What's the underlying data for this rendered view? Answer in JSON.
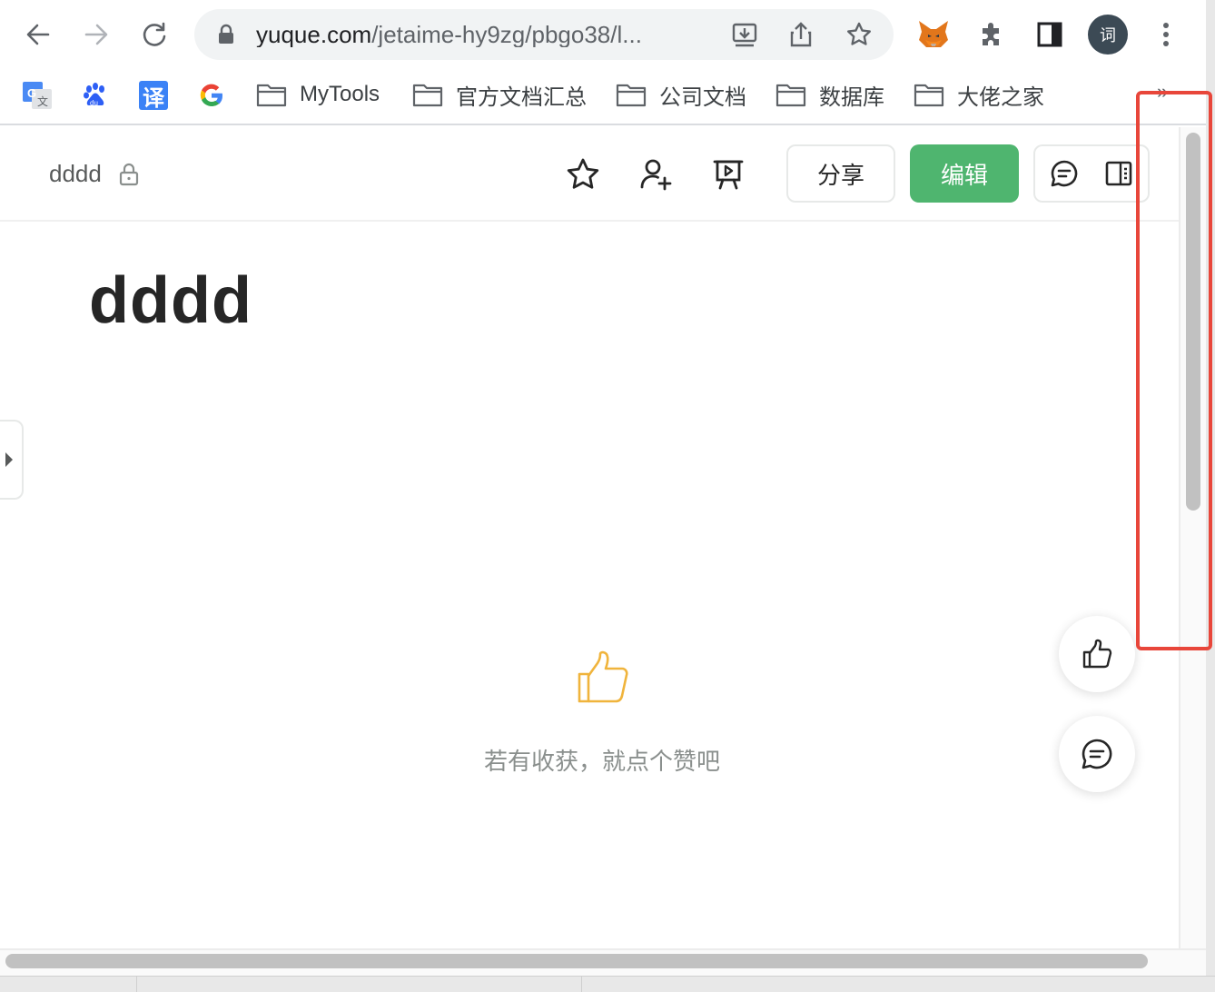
{
  "browser": {
    "url_host": "yuque.com",
    "url_path": "/jetaime-hy9zg/pbgo38/l...",
    "profile_initial": "词",
    "bookmarks": [
      {
        "label": "MyTools"
      },
      {
        "label": "官方文档汇总"
      },
      {
        "label": "公司文档"
      },
      {
        "label": "数据库"
      },
      {
        "label": "大佬之家"
      }
    ],
    "bookmark_icons": [
      "google-translate-icon",
      "baidu-icon",
      "translate-icon",
      "google-icon"
    ],
    "translate_glyph": "译",
    "more_bookmarks": "»"
  },
  "header": {
    "breadcrumb_title": "dddd",
    "share_label": "分享",
    "edit_label": "编辑"
  },
  "document": {
    "title": "dddd",
    "like_prompt": "若有收获，就点个赞吧"
  },
  "colors": {
    "accent_green": "#4fb56f",
    "like_orange": "#f0b43c",
    "annotation_red": "#e8463a"
  }
}
